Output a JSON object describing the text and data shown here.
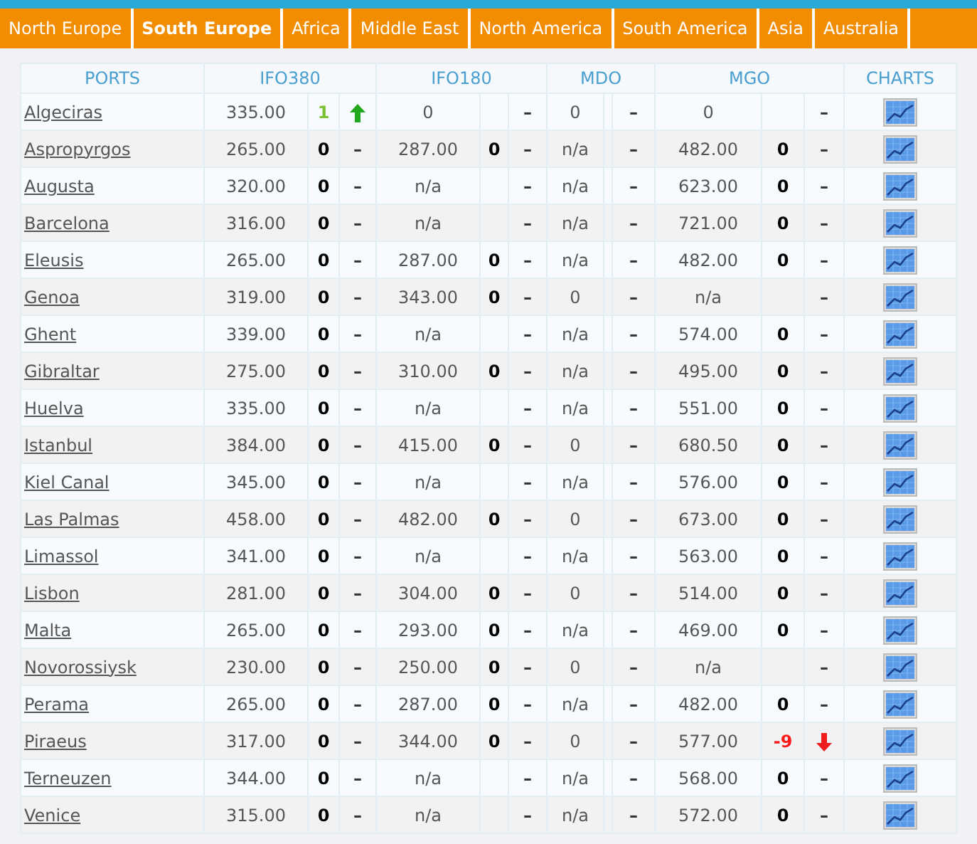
{
  "tabs": [
    {
      "label": "North Europe",
      "selected": false
    },
    {
      "label": "South Europe",
      "selected": true
    },
    {
      "label": "Africa",
      "selected": false
    },
    {
      "label": "Middle East",
      "selected": false
    },
    {
      "label": "North America",
      "selected": false
    },
    {
      "label": "South America",
      "selected": false
    },
    {
      "label": "Asia",
      "selected": false
    },
    {
      "label": "Australia",
      "selected": false
    }
  ],
  "table": {
    "columns": [
      "PORTS",
      "IFO380",
      "IFO180",
      "MDO",
      "MGO",
      "CHARTS"
    ],
    "rows": [
      {
        "port": "Algeciras",
        "fuels": [
          {
            "price": "335.00",
            "change": "1",
            "kind": "up"
          },
          {
            "price": "0",
            "mark": "–"
          },
          {
            "price": "0",
            "mark": "–"
          },
          {
            "price": "0",
            "mark": "–"
          }
        ]
      },
      {
        "port": "Aspropyrgos",
        "fuels": [
          {
            "price": "265.00",
            "change": "0",
            "mark": "–"
          },
          {
            "price": "287.00",
            "change": "0",
            "mark": "–"
          },
          {
            "price": "n/a",
            "mark": "–"
          },
          {
            "price": "482.00",
            "change": "0",
            "mark": "–"
          }
        ]
      },
      {
        "port": "Augusta",
        "fuels": [
          {
            "price": "320.00",
            "change": "0",
            "mark": "–"
          },
          {
            "price": "n/a",
            "mark": "–"
          },
          {
            "price": "n/a",
            "mark": "–"
          },
          {
            "price": "623.00",
            "change": "0",
            "mark": "–"
          }
        ]
      },
      {
        "port": "Barcelona",
        "fuels": [
          {
            "price": "316.00",
            "change": "0",
            "mark": "–"
          },
          {
            "price": "n/a",
            "mark": "–"
          },
          {
            "price": "n/a",
            "mark": "–"
          },
          {
            "price": "721.00",
            "change": "0",
            "mark": "–"
          }
        ]
      },
      {
        "port": "Eleusis",
        "fuels": [
          {
            "price": "265.00",
            "change": "0",
            "mark": "–"
          },
          {
            "price": "287.00",
            "change": "0",
            "mark": "–"
          },
          {
            "price": "n/a",
            "mark": "–"
          },
          {
            "price": "482.00",
            "change": "0",
            "mark": "–"
          }
        ]
      },
      {
        "port": "Genoa",
        "fuels": [
          {
            "price": "319.00",
            "change": "0",
            "mark": "–"
          },
          {
            "price": "343.00",
            "change": "0",
            "mark": "–"
          },
          {
            "price": "0",
            "mark": "–"
          },
          {
            "price": "n/a",
            "mark": "–"
          }
        ]
      },
      {
        "port": "Ghent",
        "fuels": [
          {
            "price": "339.00",
            "change": "0",
            "mark": "–"
          },
          {
            "price": "n/a",
            "mark": "–"
          },
          {
            "price": "n/a",
            "mark": "–"
          },
          {
            "price": "574.00",
            "change": "0",
            "mark": "–"
          }
        ]
      },
      {
        "port": "Gibraltar",
        "fuels": [
          {
            "price": "275.00",
            "change": "0",
            "mark": "–"
          },
          {
            "price": "310.00",
            "change": "0",
            "mark": "–"
          },
          {
            "price": "n/a",
            "mark": "–"
          },
          {
            "price": "495.00",
            "change": "0",
            "mark": "–"
          }
        ]
      },
      {
        "port": "Huelva",
        "fuels": [
          {
            "price": "335.00",
            "change": "0",
            "mark": "–"
          },
          {
            "price": "n/a",
            "mark": "–"
          },
          {
            "price": "n/a",
            "mark": "–"
          },
          {
            "price": "551.00",
            "change": "0",
            "mark": "–"
          }
        ]
      },
      {
        "port": "Istanbul",
        "fuels": [
          {
            "price": "384.00",
            "change": "0",
            "mark": "–"
          },
          {
            "price": "415.00",
            "change": "0",
            "mark": "–"
          },
          {
            "price": "0",
            "mark": "–"
          },
          {
            "price": "680.50",
            "change": "0",
            "mark": "–"
          }
        ]
      },
      {
        "port": "Kiel Canal",
        "fuels": [
          {
            "price": "345.00",
            "change": "0",
            "mark": "–"
          },
          {
            "price": "n/a",
            "mark": "–"
          },
          {
            "price": "n/a",
            "mark": "–"
          },
          {
            "price": "576.00",
            "change": "0",
            "mark": "–"
          }
        ]
      },
      {
        "port": "Las Palmas",
        "fuels": [
          {
            "price": "458.00",
            "change": "0",
            "mark": "–"
          },
          {
            "price": "482.00",
            "change": "0",
            "mark": "–"
          },
          {
            "price": "0",
            "mark": "–"
          },
          {
            "price": "673.00",
            "change": "0",
            "mark": "–"
          }
        ]
      },
      {
        "port": "Limassol",
        "fuels": [
          {
            "price": "341.00",
            "change": "0",
            "mark": "–"
          },
          {
            "price": "n/a",
            "mark": "–"
          },
          {
            "price": "n/a",
            "mark": "–"
          },
          {
            "price": "563.00",
            "change": "0",
            "mark": "–"
          }
        ]
      },
      {
        "port": "Lisbon",
        "fuels": [
          {
            "price": "281.00",
            "change": "0",
            "mark": "–"
          },
          {
            "price": "304.00",
            "change": "0",
            "mark": "–"
          },
          {
            "price": "0",
            "mark": "–"
          },
          {
            "price": "514.00",
            "change": "0",
            "mark": "–"
          }
        ]
      },
      {
        "port": "Malta",
        "fuels": [
          {
            "price": "265.00",
            "change": "0",
            "mark": "–"
          },
          {
            "price": "293.00",
            "change": "0",
            "mark": "–"
          },
          {
            "price": "n/a",
            "mark": "–"
          },
          {
            "price": "469.00",
            "change": "0",
            "mark": "–"
          }
        ]
      },
      {
        "port": "Novorossiysk",
        "fuels": [
          {
            "price": "230.00",
            "change": "0",
            "mark": "–"
          },
          {
            "price": "250.00",
            "change": "0",
            "mark": "–"
          },
          {
            "price": "0",
            "mark": "–"
          },
          {
            "price": "n/a",
            "mark": "–"
          }
        ]
      },
      {
        "port": "Perama",
        "fuels": [
          {
            "price": "265.00",
            "change": "0",
            "mark": "–"
          },
          {
            "price": "287.00",
            "change": "0",
            "mark": "–"
          },
          {
            "price": "n/a",
            "mark": "–"
          },
          {
            "price": "482.00",
            "change": "0",
            "mark": "–"
          }
        ]
      },
      {
        "port": "Piraeus",
        "fuels": [
          {
            "price": "317.00",
            "change": "0",
            "mark": "–"
          },
          {
            "price": "344.00",
            "change": "0",
            "mark": "–"
          },
          {
            "price": "0",
            "mark": "–"
          },
          {
            "price": "577.00",
            "change": "-9",
            "kind": "down"
          }
        ]
      },
      {
        "port": "Terneuzen",
        "fuels": [
          {
            "price": "344.00",
            "change": "0",
            "mark": "–"
          },
          {
            "price": "n/a",
            "mark": "–"
          },
          {
            "price": "n/a",
            "mark": "–"
          },
          {
            "price": "568.00",
            "change": "0",
            "mark": "–"
          }
        ]
      },
      {
        "port": "Venice",
        "fuels": [
          {
            "price": "315.00",
            "change": "0",
            "mark": "–"
          },
          {
            "price": "n/a",
            "mark": "–"
          },
          {
            "price": "n/a",
            "mark": "–"
          },
          {
            "price": "572.00",
            "change": "0",
            "mark": "–"
          }
        ]
      }
    ]
  }
}
